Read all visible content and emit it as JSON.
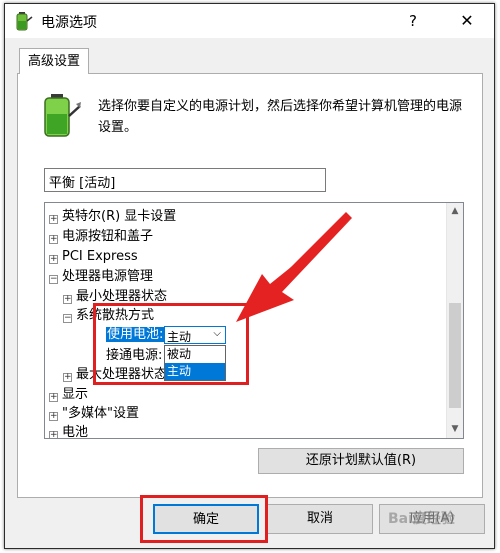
{
  "window": {
    "title": "电源选项",
    "help_label": "?",
    "close_label": "✕"
  },
  "tab": {
    "label": "高级设置"
  },
  "description": "选择你要自定义的电源计划，然后选择你希望计算机管理的电源设置。",
  "plan_select": {
    "value": "平衡 [活动]"
  },
  "tree": {
    "items": [
      {
        "label": "英特尔(R) 显卡设置",
        "toggle": "+"
      },
      {
        "label": "电源按钮和盖子",
        "toggle": "+"
      },
      {
        "label": "PCI Express",
        "toggle": "+"
      },
      {
        "label": "处理器电源管理",
        "toggle": "−"
      },
      {
        "label": "最小处理器状态",
        "toggle": "+"
      },
      {
        "label": "系统散热方式",
        "toggle": "−"
      },
      {
        "label": "使用电池:"
      },
      {
        "label": "接通电源:"
      },
      {
        "label": "最大处理器状态",
        "toggle": "+"
      },
      {
        "label": "显示",
        "toggle": "+"
      },
      {
        "label": "\"多媒体\"设置",
        "toggle": "+"
      },
      {
        "label": "电池",
        "toggle": "+"
      }
    ],
    "battery_value": "主动",
    "dropdown_options": [
      "被动",
      "主动"
    ]
  },
  "buttons": {
    "restore": "还原计划默认值(R)",
    "ok": "确定",
    "cancel": "取消",
    "apply": "应用(A)"
  },
  "watermark": "Bai度经验",
  "colors": {
    "accent": "#0078d7",
    "highlight_red": "#e02020"
  }
}
